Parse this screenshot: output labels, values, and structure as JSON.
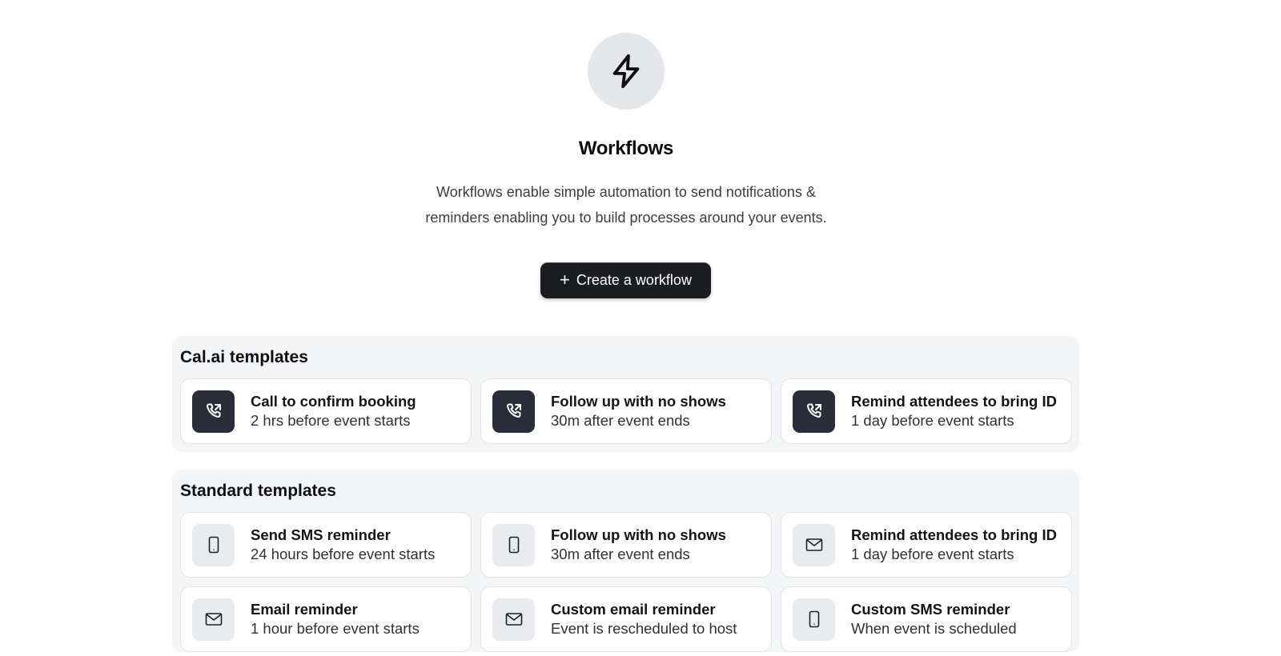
{
  "hero": {
    "icon": "lightning-bolt-icon",
    "title": "Workflows",
    "description_line1": "Workflows enable simple automation to send notifications &",
    "description_line2": "reminders enabling you to build processes around your events.",
    "create_button_icon": "+",
    "create_button_label": "Create a workflow"
  },
  "calai": {
    "title": "Cal.ai templates",
    "cards": [
      {
        "icon": "phone-call-icon",
        "title": "Call to confirm booking",
        "subtitle": "2 hrs before event starts"
      },
      {
        "icon": "phone-call-icon",
        "title": "Follow up with no shows",
        "subtitle": "30m after event ends"
      },
      {
        "icon": "phone-call-icon",
        "title": "Remind attendees to bring ID",
        "subtitle": "1 day before event starts"
      }
    ]
  },
  "standard": {
    "title": "Standard templates",
    "cards": [
      {
        "icon": "smartphone-icon",
        "title": "Send SMS reminder",
        "subtitle": "24 hours before event starts"
      },
      {
        "icon": "smartphone-icon",
        "title": "Follow up with no shows",
        "subtitle": "30m after event ends"
      },
      {
        "icon": "mail-icon",
        "title": "Remind attendees to bring ID",
        "subtitle": "1 day before event starts"
      },
      {
        "icon": "mail-icon",
        "title": "Email reminder",
        "subtitle": "1 hour before event starts"
      },
      {
        "icon": "mail-icon",
        "title": "Custom email reminder",
        "subtitle": "Event is rescheduled to host"
      },
      {
        "icon": "smartphone-icon",
        "title": "Custom SMS reminder",
        "subtitle": "When event is scheduled"
      }
    ]
  },
  "colors": {
    "primary_button": "#1c1d21",
    "section_bg": "#f4f5f7",
    "calai_icon_bg": "#2b2c3a",
    "standard_icon_bg": "#eaebee"
  }
}
